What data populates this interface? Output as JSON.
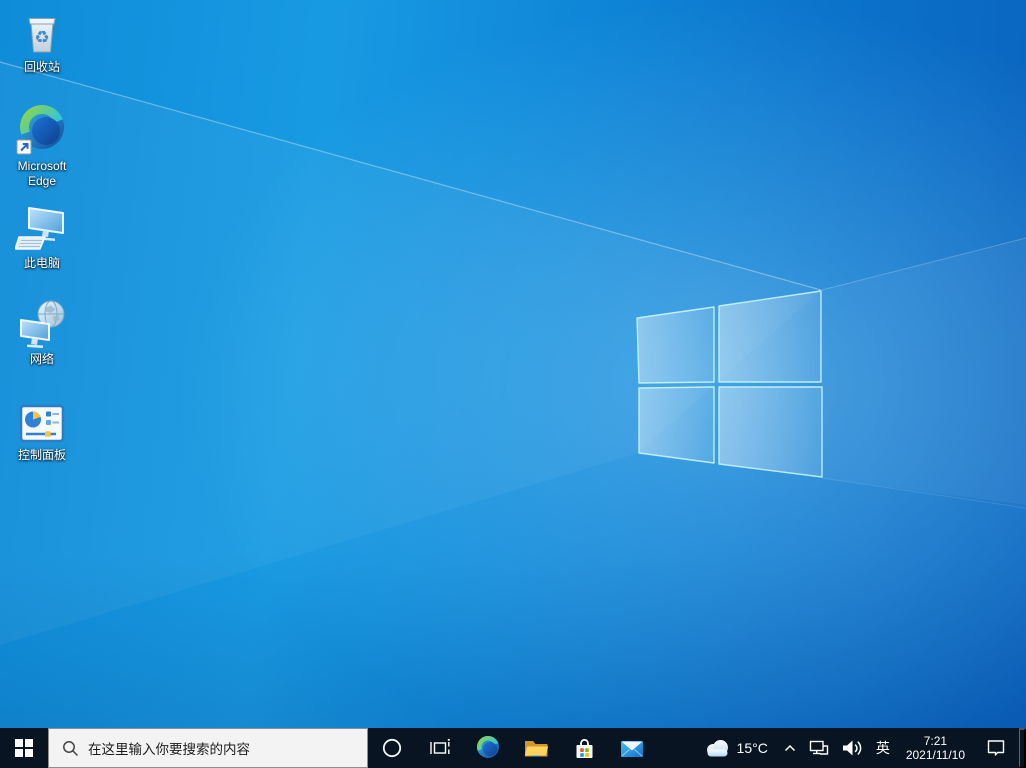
{
  "colors": {
    "taskbar_bg": "#081421",
    "search_bg": "#f3f3f3",
    "wallpaper_base": "#0f87d8",
    "logo_edge_cyan": "#bff0f6",
    "ms_red": "#f25022",
    "ms_green": "#7fba00",
    "ms_blue": "#00a4ef",
    "ms_yellow": "#ffb900"
  },
  "desktop": {
    "icons": [
      {
        "name": "recycle-bin",
        "label": "回收站"
      },
      {
        "name": "microsoft-edge",
        "label": "Microsoft Edge"
      },
      {
        "name": "this-pc",
        "label": "此电脑"
      },
      {
        "name": "network",
        "label": "网络"
      },
      {
        "name": "control-panel",
        "label": "控制面板"
      }
    ]
  },
  "taskbar": {
    "search": {
      "placeholder": "在这里输入你要搜索的内容"
    },
    "buttons": [
      "start",
      "cortana",
      "task-view",
      "edge",
      "file-explorer",
      "store",
      "mail"
    ],
    "tray": {
      "temperature": "15°C",
      "ime": "英",
      "time": "7:21",
      "date": "2021/11/10"
    },
    "tray_icons": [
      "weather-cloud",
      "tray-expand-chevron",
      "ethernet",
      "volume",
      "ime-indicator",
      "clock",
      "action-center",
      "show-desktop"
    ]
  }
}
